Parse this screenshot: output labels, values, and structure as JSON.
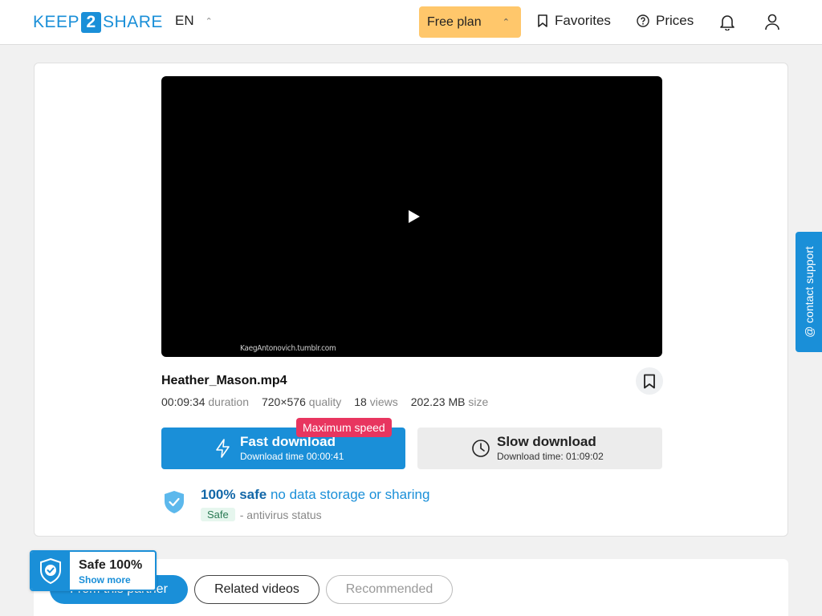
{
  "header": {
    "logo_left": "KEEP",
    "logo_num": "2",
    "logo_right": "SHARE",
    "language": "EN",
    "free_plan_label": "Free plan",
    "favorites_label": "Favorites",
    "prices_label": "Prices"
  },
  "video": {
    "watermark": "KaegAntonovich.tumblr.com"
  },
  "file": {
    "name": "Heather_Mason.mp4",
    "duration_value": "00:09:34",
    "duration_label": "duration",
    "quality_value": "720×576",
    "quality_label": "quality",
    "views_value": "18",
    "views_label": "views",
    "size_value": "202.23 MB",
    "size_label": "size"
  },
  "download": {
    "fast_label": "Fast download",
    "fast_time": "Download time 00:00:41",
    "max_speed_badge": "Maximum speed",
    "slow_label": "Slow download",
    "slow_time": "Download time: 01:09:02"
  },
  "safety": {
    "title_bold": "100% safe",
    "title_rest": "no data storage or sharing",
    "tag": "Safe",
    "status_text": "- antivirus status"
  },
  "support_label": "@ contact support",
  "tabs": {
    "partner": "From this partner",
    "related": "Related videos",
    "recommended": "Recommended"
  },
  "safe_badge": {
    "line1": "Safe 100%",
    "line2": "Show more"
  },
  "colors": {
    "accent": "#1a8fd8",
    "plan": "#ffc76b",
    "badge": "#e8355f"
  }
}
